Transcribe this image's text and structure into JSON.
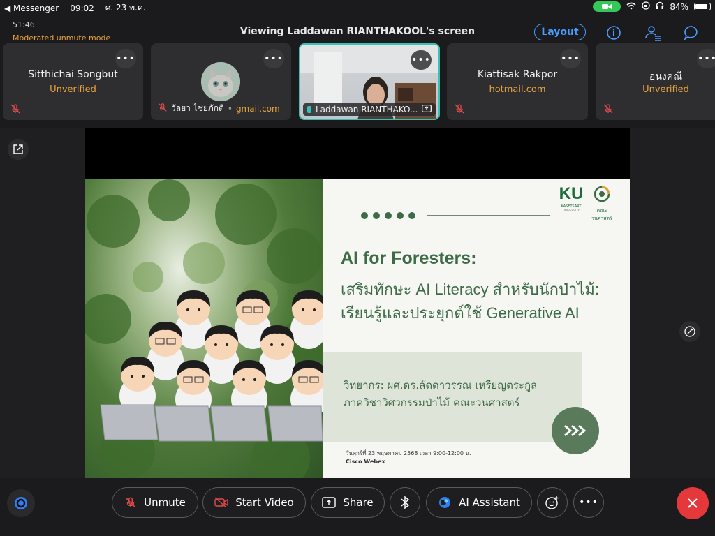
{
  "status_bar": {
    "back_app": "◀ Messenger",
    "time": "09:02",
    "date": "ศ. 23 พ.ค.",
    "battery": "84%"
  },
  "header": {
    "timer": "51:46",
    "mode": "Moderated unmute mode",
    "title": "Viewing Laddawan RIANTHAKOOL's screen",
    "layout_label": "Layout"
  },
  "participants": [
    {
      "name": "Sitthichai Songbut",
      "sub": "Unverified",
      "more": "•••"
    },
    {
      "name": "วัลยา ไชยภักดี",
      "sub": "gmail.com",
      "more": "•••"
    },
    {
      "name": "Laddawan RIANTHAKO...",
      "more": "•••"
    },
    {
      "name": "Kiattisak Rakpor",
      "sub": "hotmail.com",
      "more": "•••"
    },
    {
      "name": "อนงคณี",
      "sub": "Unverified",
      "more": "•••"
    }
  ],
  "slide": {
    "ku_logo": "KU",
    "ku_sub1": "KASETSART",
    "ku_sub2": "UNIVERSITY",
    "faculty_logo_text": "คณะวนศาสตร์",
    "title": "AI for Foresters:",
    "subtitle_line1": "เสริมทักษะ AI Literacy สำหรับนักป่าไม้:",
    "subtitle_line2": "เรียนรู้และประยุกต์ใช้ Generative AI",
    "speaker_line1": "วิทยากร: ผศ.ดร.ลัดดาวรรณ เหรียญตระกูล",
    "speaker_line2": "ภาควิชาวิศวกรรมป่าไม้ คณะวนศาสตร์",
    "date_line": "วันศุกร์ที่ 23 พฤษภาคม 2568 เวลา 9:00-12:00 น.",
    "platform_line": "Cisco Webex"
  },
  "toolbar": {
    "unmute": "Unmute",
    "start_video": "Start Video",
    "share": "Share",
    "ai_assistant": "AI Assistant",
    "more": "•••"
  },
  "colors": {
    "accent_orange": "#e8a33c",
    "accent_blue": "#4a9cff",
    "mute_red": "#e24b4b",
    "leave_red": "#e5383b",
    "slide_green": "#3d6b47",
    "active_border": "#35c1b5"
  }
}
